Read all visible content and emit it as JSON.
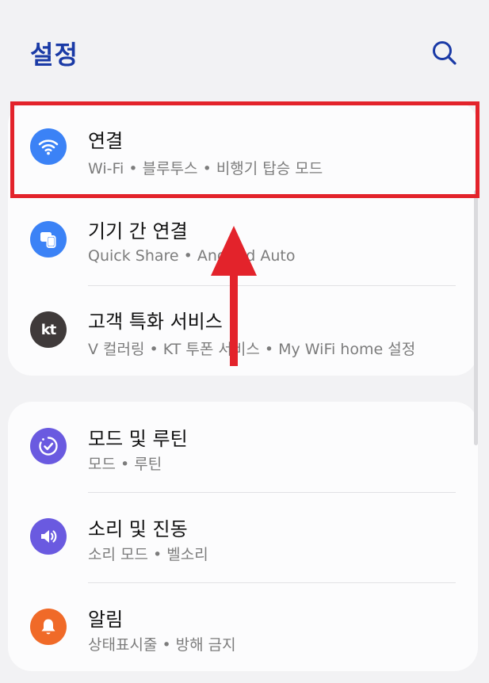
{
  "header": {
    "title": "설정",
    "search_icon": "search-icon"
  },
  "groups": [
    {
      "items": [
        {
          "title": "연결",
          "subtitle": "Wi-Fi • 블루투스 • 비행기 탑승 모드",
          "icon": "wifi-icon",
          "icon_color": "#3b82f6"
        },
        {
          "title": "기기 간 연결",
          "subtitle": "Quick Share • Android Auto",
          "icon": "devices-icon",
          "icon_color": "#3b82f6"
        },
        {
          "title": "고객 특화 서비스",
          "subtitle": "V 컬러링 • KT 투폰 서비스 • My WiFi home 설정",
          "icon": "kt-logo-icon",
          "icon_color": "#3f3a3a",
          "icon_text": "kt"
        }
      ]
    },
    {
      "items": [
        {
          "title": "모드 및 루틴",
          "subtitle": "모드 • 루틴",
          "icon": "routine-check-icon",
          "icon_color": "#6a5ae0"
        },
        {
          "title": "소리 및 진동",
          "subtitle": "소리 모드 • 벨소리",
          "icon": "speaker-icon",
          "icon_color": "#6a5ae0"
        },
        {
          "title": "알림",
          "subtitle": "상태표시줄 • 방해 금지",
          "icon": "bell-icon",
          "icon_color": "#f06a28"
        }
      ]
    }
  ],
  "annotation": {
    "box_color": "#e3232b",
    "arrow_color": "#e3232b"
  }
}
